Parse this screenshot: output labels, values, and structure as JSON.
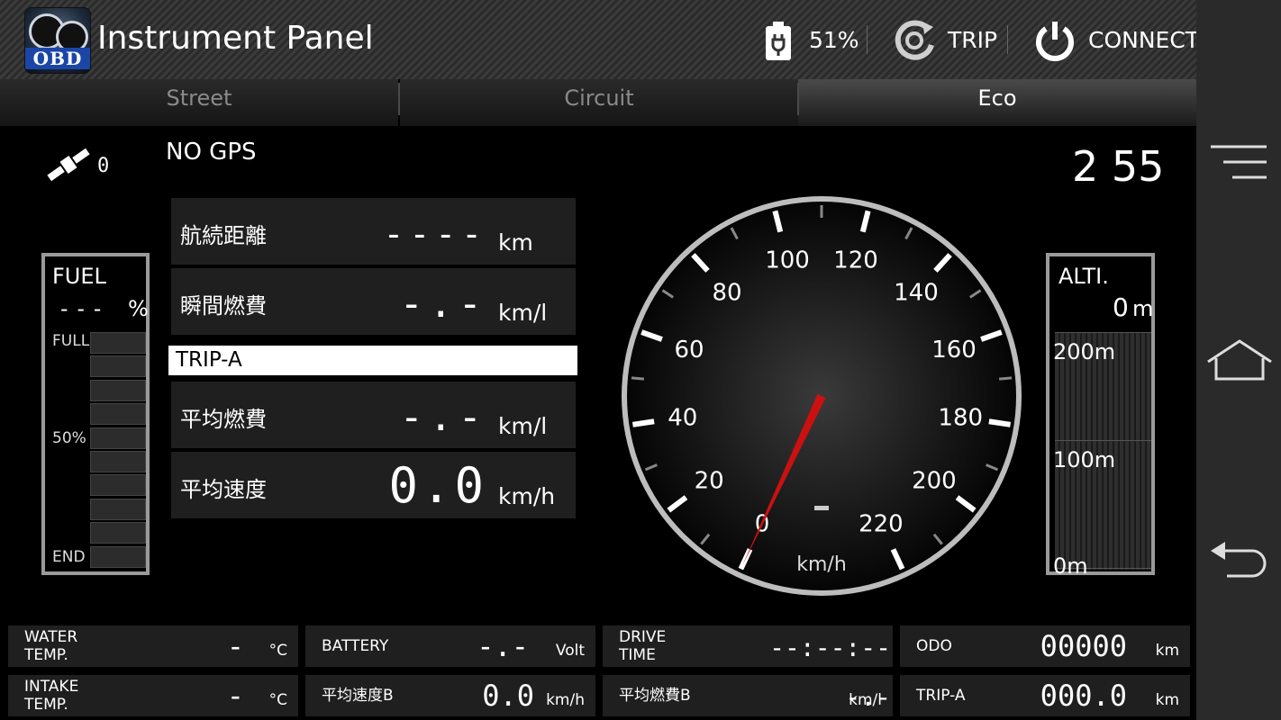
{
  "header": {
    "title": "Instrument Panel",
    "app_icon_text": "OBD",
    "battery": "51%",
    "trip": "TRIP",
    "connect": "CONNECT"
  },
  "tabs": [
    {
      "label": "Street",
      "active": false
    },
    {
      "label": "Circuit",
      "active": false
    },
    {
      "label": "Eco",
      "active": true
    }
  ],
  "gps": {
    "satellites": "0",
    "status": "NO GPS"
  },
  "clock": "2 55",
  "info": {
    "range": {
      "label": "航続距離",
      "value": "----",
      "unit": "km"
    },
    "instant_fuel": {
      "label": "瞬間燃費",
      "value": "-.-",
      "unit": "km/l"
    },
    "trip_label": "TRIP-A",
    "avg_fuel": {
      "label": "平均燃費",
      "value": "-.-",
      "unit": "km/l"
    },
    "avg_speed": {
      "label": "平均速度",
      "value": "0.0",
      "unit": "km/h"
    }
  },
  "fuel": {
    "label": "FUEL",
    "value": "---",
    "unit": "%",
    "full": "FULL",
    "half": "50%",
    "end": "END"
  },
  "altitude": {
    "label": "ALTI.",
    "value": "0",
    "unit": "m",
    "t200": "200m",
    "t100": "100m",
    "t0": "0m"
  },
  "speedometer": {
    "labels": [
      "0",
      "20",
      "40",
      "60",
      "80",
      "100",
      "120",
      "140",
      "160",
      "180",
      "200",
      "220"
    ],
    "unit": "km/h",
    "digital": "-",
    "speed": 0,
    "min": 0,
    "max": 220,
    "needle_color": "#cc1010"
  },
  "bottom": [
    {
      "label1": "WATER",
      "label2": "TEMP.",
      "value": "-",
      "unit": "°C"
    },
    {
      "label1": "BATTERY",
      "label2": "",
      "value": "-.-",
      "unit": "Volt"
    },
    {
      "label1": "DRIVE",
      "label2": "TIME",
      "value": "--:--:--",
      "unit": ""
    },
    {
      "label1": "ODO",
      "label2": "",
      "value": "00000",
      "unit": "km"
    },
    {
      "label1": "INTAKE",
      "label2": "TEMP.",
      "value": "-",
      "unit": "°C"
    },
    {
      "label1": "平均速度B",
      "label2": "",
      "value": "0.0",
      "unit": "km/h"
    },
    {
      "label1": "平均燃費B",
      "label2": "",
      "value": "-.-",
      "unit": "km/l"
    },
    {
      "label1": "TRIP-A",
      "label2": "",
      "value": "000.0",
      "unit": "km"
    }
  ]
}
